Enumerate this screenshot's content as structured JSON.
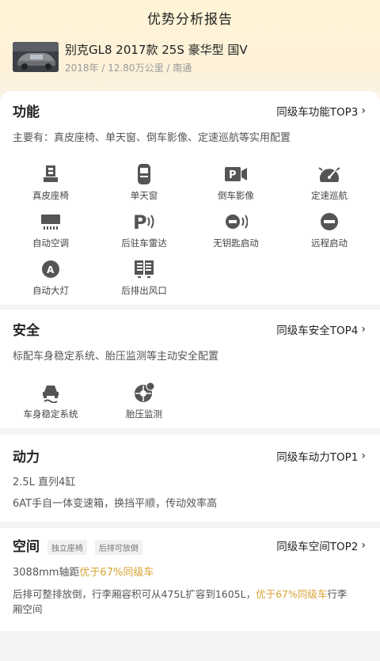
{
  "header": {
    "title": "优势分析报告",
    "car_name": "别克GL8 2017款 25S 豪华型 国V",
    "car_meta": "2018年 / 12.80万公里 / 南通"
  },
  "function": {
    "title": "功能",
    "rank": "同级车功能TOP3",
    "desc": "主要有：真皮座椅、单天窗、倒车影像、定速巡航等实用配置",
    "features": [
      {
        "label": "真皮座椅",
        "icon": "leather-seat-icon"
      },
      {
        "label": "单天窗",
        "icon": "sunroof-icon"
      },
      {
        "label": "倒车影像",
        "icon": "reverse-camera-icon"
      },
      {
        "label": "定速巡航",
        "icon": "cruise-control-icon"
      },
      {
        "label": "自动空调",
        "icon": "auto-ac-icon"
      },
      {
        "label": "后驻车雷达",
        "icon": "parking-radar-icon"
      },
      {
        "label": "无钥匙启动",
        "icon": "keyless-start-icon"
      },
      {
        "label": "远程启动",
        "icon": "remote-start-icon"
      },
      {
        "label": "自动大灯",
        "icon": "auto-headlight-icon"
      },
      {
        "label": "后排出风口",
        "icon": "rear-vent-icon"
      }
    ]
  },
  "safety": {
    "title": "安全",
    "rank": "同级车安全TOP4",
    "desc": "标配车身稳定系统、胎压监测等主动安全配置",
    "features": [
      {
        "label": "车身稳定系统",
        "icon": "stability-control-icon"
      },
      {
        "label": "胎压监测",
        "icon": "tire-pressure-icon"
      }
    ]
  },
  "power": {
    "title": "动力",
    "rank": "同级车动力TOP1",
    "line1": "2.5L 直列4缸",
    "line2": "6AT手自一体变速箱，换挡平顺，传动效率高"
  },
  "space": {
    "title": "空间",
    "rank": "同级车空间TOP2",
    "tags": [
      "独立座椅",
      "后排可放倒"
    ],
    "wheelbase": "3088mm轴距",
    "wheelbase_hl": "优于67%同级车",
    "trunk_prefix": "后排可整排放倒，行李厢容积可从475L扩容到1605L，",
    "trunk_hl": "优于67%同级车",
    "trunk_suffix": "行李",
    "trunk_wrap": "厢空间"
  },
  "colors": {
    "accent": "#d9a233",
    "icon": "#555555"
  }
}
